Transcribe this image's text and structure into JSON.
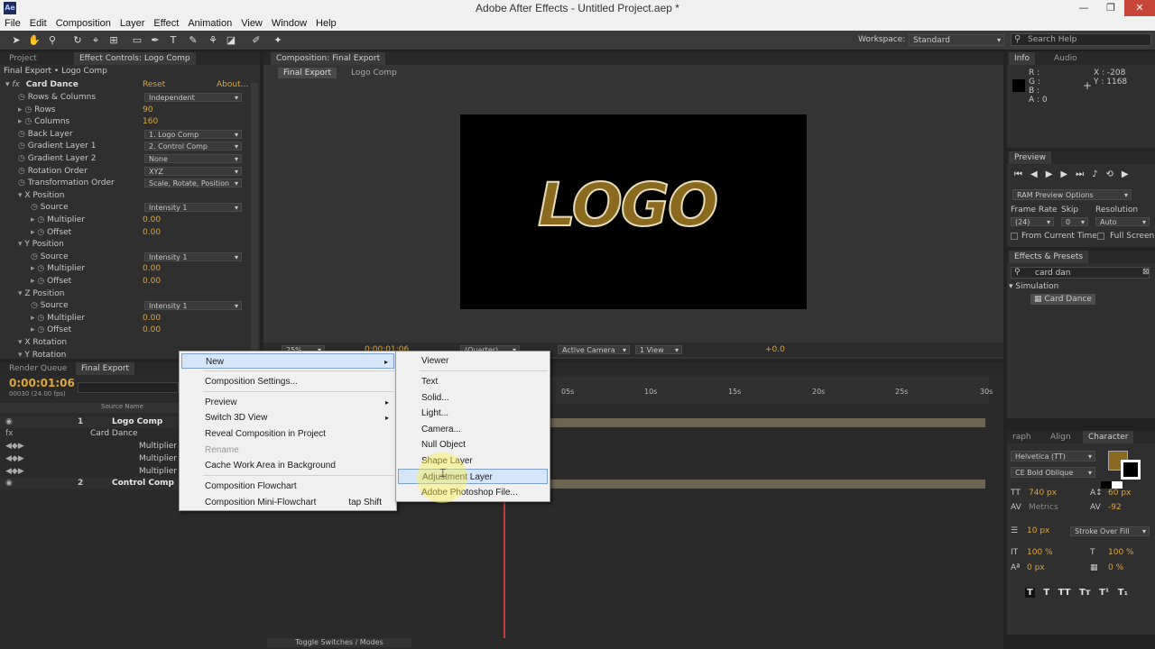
{
  "window": {
    "title": "Adobe After Effects - Untitled Project.aep *",
    "app_icon": "Ae",
    "min": "—",
    "max": "❐",
    "close": "✕"
  },
  "menubar": [
    "File",
    "Edit",
    "Composition",
    "Layer",
    "Effect",
    "Animation",
    "View",
    "Window",
    "Help"
  ],
  "toolbar": {
    "workspace_label": "Workspace:",
    "workspace_value": "Standard",
    "search_placeholder": "Search Help"
  },
  "left_panel": {
    "tabs": [
      "Project",
      "Effect Controls: Logo Comp"
    ],
    "breadcrumb": "Final Export • Logo Comp",
    "effect_name": "Card Dance",
    "reset": "Reset",
    "about": "About...",
    "rows": [
      {
        "label": "Rows & Columns",
        "value": "Independent",
        "kind": "dd"
      },
      {
        "label": "Rows",
        "value": "90",
        "kind": "num"
      },
      {
        "label": "Columns",
        "value": "160",
        "kind": "num"
      },
      {
        "label": "Back Layer",
        "value": "1. Logo Comp",
        "kind": "dd"
      },
      {
        "label": "Gradient Layer 1",
        "value": "2. Control Comp",
        "kind": "dd"
      },
      {
        "label": "Gradient Layer 2",
        "value": "None",
        "kind": "dd"
      },
      {
        "label": "Rotation Order",
        "value": "XYZ",
        "kind": "dd"
      },
      {
        "label": "Transformation Order",
        "value": "Scale, Rotate, Position",
        "kind": "dd"
      },
      {
        "label": "X Position",
        "value": "",
        "kind": "group"
      },
      {
        "label": "Source",
        "value": "Intensity 1",
        "kind": "dd"
      },
      {
        "label": "Multiplier",
        "value": "0.00",
        "kind": "num"
      },
      {
        "label": "Offset",
        "value": "0.00",
        "kind": "num"
      },
      {
        "label": "Y Position",
        "value": "",
        "kind": "group"
      },
      {
        "label": "Source",
        "value": "Intensity 1",
        "kind": "dd"
      },
      {
        "label": "Multiplier",
        "value": "0.00",
        "kind": "num"
      },
      {
        "label": "Offset",
        "value": "0.00",
        "kind": "num"
      },
      {
        "label": "Z Position",
        "value": "",
        "kind": "group"
      },
      {
        "label": "Source",
        "value": "Intensity 1",
        "kind": "dd"
      },
      {
        "label": "Multiplier",
        "value": "0.00",
        "kind": "num"
      },
      {
        "label": "Offset",
        "value": "0.00",
        "kind": "num"
      },
      {
        "label": "X Rotation",
        "value": "",
        "kind": "group"
      },
      {
        "label": "Y Rotation",
        "value": "",
        "kind": "group"
      }
    ]
  },
  "comp_panel": {
    "tab": "Composition: Final Export",
    "crumbs": [
      "Final Export",
      "Logo Comp"
    ],
    "logo_text": "LOGO",
    "zoom": "25%",
    "timecode": "0;00;01;06",
    "resolution": "(Quarter)",
    "camera": "Active Camera",
    "view": "1 View",
    "exposure": "+0.0"
  },
  "info": {
    "tabs": [
      "Info",
      "Audio"
    ],
    "r": "R :",
    "g": "G :",
    "b": "B :",
    "a": "A : 0",
    "x": "X : -208",
    "y": "Y : 1168"
  },
  "preview": {
    "tab": "Preview",
    "ram": "RAM Preview Options",
    "frame_rate_label": "Frame Rate",
    "skip_label": "Skip",
    "resolution_label": "Resolution",
    "frame_rate": "(24)",
    "skip": "0",
    "resolution": "Auto",
    "from_current": "From Current Time",
    "full_screen": "Full Screen"
  },
  "effects_presets": {
    "tab": "Effects & Presets",
    "search": "card dan",
    "category": "Simulation",
    "item": "Card Dance"
  },
  "character": {
    "tabs": [
      "raph",
      "Align",
      "Character"
    ],
    "font": "Helvetica (TT)",
    "style": "CE Bold Oblique",
    "size": "740 px",
    "leading": "60 px",
    "kerning": "Metrics",
    "tracking": "-92",
    "stroke": "10 px",
    "stroke_mode": "Stroke Over Fill",
    "vscale": "100 %",
    "hscale": "100 %",
    "baseline": "0 px",
    "tsume": "0 %",
    "fill_color": "#8a6a1e",
    "styles": [
      "T",
      "T",
      "TT",
      "Tᴛ",
      "T¹",
      "T₁"
    ]
  },
  "timeline": {
    "tabs": [
      "Render Queue",
      "Final Export"
    ],
    "timecode": "0:00:01:06",
    "fps": "00030 (24.00 fps)",
    "col_source": "Source Name",
    "layers": [
      {
        "num": "1",
        "name": "Logo Comp"
      },
      {
        "num": "",
        "name": "Card Dance"
      },
      {
        "num": "",
        "name": "Multiplier"
      },
      {
        "num": "",
        "name": "Multiplier"
      },
      {
        "num": "",
        "name": "Multiplier"
      },
      {
        "num": "2",
        "name": "Control Comp"
      }
    ],
    "ruler": [
      "05s",
      "10s",
      "15s",
      "20s",
      "25s",
      "30s"
    ],
    "toggle": "Toggle Switches / Modes"
  },
  "context_menu": {
    "items": [
      {
        "label": "New",
        "submenu": true,
        "state": "hl"
      },
      {
        "label": "Composition Settings..."
      },
      {
        "label": "Preview",
        "submenu": true
      },
      {
        "label": "Switch 3D View",
        "submenu": true
      },
      {
        "label": "Reveal Composition in Project"
      },
      {
        "label": "Rename",
        "state": "dim"
      },
      {
        "label": "Cache Work Area in Background"
      },
      {
        "label": "Composition Flowchart"
      },
      {
        "label": "Composition Mini-Flowchart",
        "shortcut": "tap Shift"
      }
    ]
  },
  "submenu": {
    "items": [
      "Viewer",
      "Text",
      "Solid...",
      "Light...",
      "Camera...",
      "Null Object",
      "Shape Layer",
      "Adjustment Layer",
      "Adobe Photoshop File..."
    ],
    "highlighted": "Adjustment Layer"
  },
  "colors": {
    "accent": "#e0a43a",
    "logo_fill": "#8a6a1e",
    "menu_highlight": "#d6e6f9",
    "playhead": "#c23a3a"
  }
}
